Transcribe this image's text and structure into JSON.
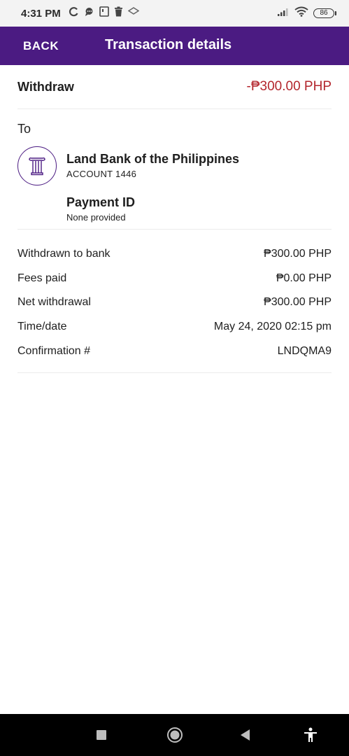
{
  "status_bar": {
    "time": "4:31 PM",
    "battery": "86"
  },
  "app_bar": {
    "back_label": "BACK",
    "title": "Transaction details"
  },
  "summary": {
    "type": "Withdraw",
    "amount": "-₱300.00 PHP"
  },
  "recipient": {
    "to_label": "To",
    "bank_name": "Land Bank of the Philippines",
    "account": "ACCOUNT 1446",
    "payment_id_label": "Payment ID",
    "payment_id_value": "None provided"
  },
  "details": [
    {
      "label": "Withdrawn to bank",
      "value": "₱300.00 PHP"
    },
    {
      "label": "Fees paid",
      "value": "₱0.00 PHP"
    },
    {
      "label": "Net withdrawal",
      "value": "₱300.00 PHP"
    },
    {
      "label": "Time/date",
      "value": "May 24, 2020 02:15 pm"
    },
    {
      "label": "Confirmation #",
      "value": "LNDQMA9"
    }
  ],
  "icons": {
    "bank": "bank-column-icon",
    "nav": [
      "recents-icon",
      "home-icon",
      "back-icon",
      "accessibility-icon"
    ]
  },
  "colors": {
    "app_bar": "#4b1b82",
    "negative_amount": "#b3262d"
  }
}
